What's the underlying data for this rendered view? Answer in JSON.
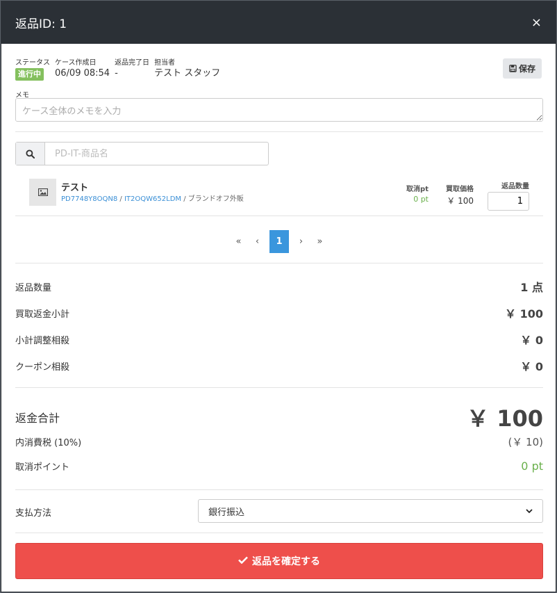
{
  "header": {
    "title": "返品ID: 1",
    "close": "×"
  },
  "meta": {
    "status_label": "ステータス",
    "status_value": "進行中",
    "created_label": "ケース作成日",
    "created_value": "06/09 08:54",
    "done_label": "返品完了日",
    "done_value": "-",
    "staff_label": "担当者",
    "staff_value": "テスト スタッフ"
  },
  "save_label": "保存",
  "memo": {
    "label": "メモ",
    "placeholder": "ケース全体のメモを入力"
  },
  "search": {
    "placeholder": "PD-IT-商品名"
  },
  "item": {
    "name": "テスト",
    "code1": "PD7748Y8OQN8",
    "sep1": " / ",
    "code2": "IT2OQW652LDM",
    "sep2": " / ",
    "brand": "ブランドオフ外販",
    "cancel_pt_label": "取消pt",
    "cancel_pt_value": "0 pt",
    "price_label": "買取価格",
    "price_value": "￥ 100",
    "qty_label": "返品数量",
    "qty_value": "1"
  },
  "pager": {
    "first": "«",
    "prev": "‹",
    "current": "1",
    "next": "›",
    "last": "»"
  },
  "summary": {
    "qty_label": "返品数量",
    "qty_value": "1 点",
    "subtotal_label": "買取返金小計",
    "subtotal_value": "￥ 100",
    "adjust_label": "小計調整相殺",
    "adjust_value": "￥ 0",
    "coupon_label": "クーポン相殺",
    "coupon_value": "￥ 0",
    "total_label": "返金合計",
    "total_value": "￥ 100",
    "tax_label": "内消費税 (10%)",
    "tax_value": "(￥ 10)",
    "points_label": "取消ポイント",
    "points_value": "0 pt"
  },
  "payment": {
    "label": "支払方法",
    "value": "銀行振込"
  },
  "confirm_label": "返品を確定する",
  "colors": {
    "accent": "#3a96dd",
    "danger": "#ee4f4b",
    "success": "#84c05e",
    "header": "#2b3036"
  }
}
